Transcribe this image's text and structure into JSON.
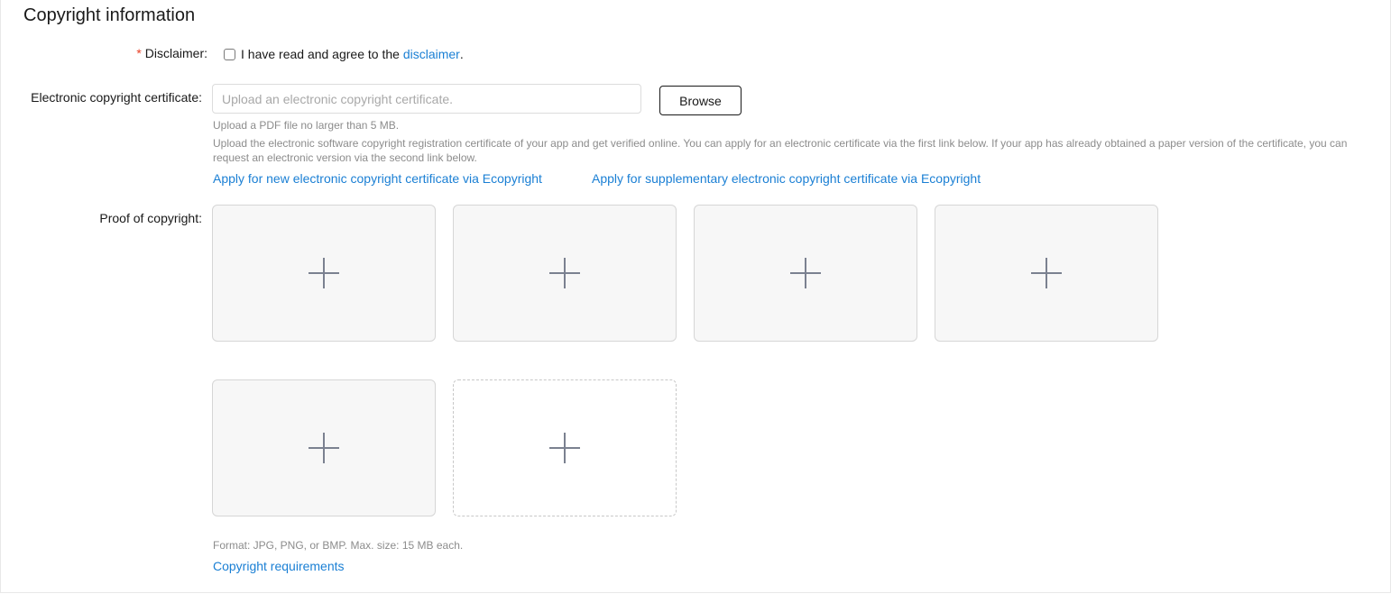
{
  "section": {
    "title": "Copyright information"
  },
  "disclaimer": {
    "required_mark": "*",
    "label": "Disclaimer:",
    "text": "I have read and agree to the ",
    "link": "disclaimer",
    "suffix": ".",
    "checked": false
  },
  "certificate": {
    "label": "Electronic copyright certificate:",
    "placeholder": "Upload an electronic copyright certificate.",
    "value": "",
    "browse_label": "Browse",
    "hint_size": "Upload a PDF file no larger than 5 MB.",
    "hint_long": "Upload the electronic software copyright registration certificate of your app and get verified online. You can apply for an electronic certificate via the first link below. If your app has already obtained a paper version of the certificate, you can request an electronic version via the second link below.",
    "link_new": "Apply for new electronic copyright certificate via Ecopyright",
    "link_supplementary": "Apply for supplementary electronic copyright certificate via Ecopyright"
  },
  "proof": {
    "label": "Proof of copyright:",
    "format_hint": "Format: JPG, PNG, or BMP. Max. size: 15 MB each.",
    "requirements_link": "Copyright requirements"
  },
  "colors": {
    "link": "#1a7fd4",
    "required": "#e84026",
    "hint": "#8c8c8c",
    "box_bg": "#f7f7f7",
    "plus": "#7b8190"
  }
}
